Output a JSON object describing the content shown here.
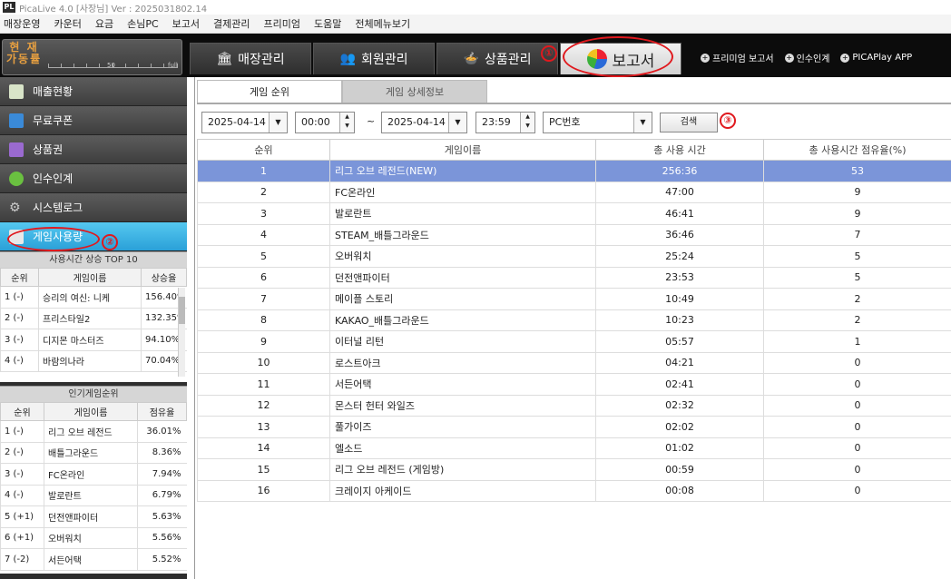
{
  "titlebar": {
    "logo": "PL",
    "title": "PicaLive 4.0 [사장님] Ver : 2025031802.14"
  },
  "menu": [
    "매장운영",
    "카운터",
    "요금",
    "손님PC",
    "보고서",
    "결제관리",
    "프리미엄",
    "도움말",
    "전체메뉴보기"
  ],
  "gauge": {
    "label_line1": "현 재",
    "label_line2": "가동률",
    "mark_mid": "50",
    "mark_end": "full"
  },
  "main_tabs": [
    {
      "label": "매장관리",
      "icon": "store-icon"
    },
    {
      "label": "회원관리",
      "icon": "members-icon"
    },
    {
      "label": "상품관리",
      "icon": "product-icon"
    },
    {
      "label": "보고서",
      "icon": "pie-chart-icon"
    }
  ],
  "top_links": [
    "프리미엄 보고서",
    "인수인계",
    "PICAPlay APP"
  ],
  "sidebar": {
    "items": [
      "매출현황",
      "무료쿠폰",
      "상품권",
      "인수인계",
      "시스템로그",
      "게임사용량"
    ],
    "active": "게임사용량"
  },
  "rising": {
    "title": "사용시간 상승 TOP 10",
    "headers": [
      "순위",
      "게임이름",
      "상승율"
    ],
    "rows": [
      [
        "1 (-)",
        "승리의 여신: 니케",
        "156.40%"
      ],
      [
        "2 (-)",
        "프리스타일2",
        "132.35%"
      ],
      [
        "3 (-)",
        "디지몬 마스터즈",
        "94.10%"
      ],
      [
        "4 (-)",
        "바람의나라",
        "70.04%"
      ]
    ]
  },
  "popular": {
    "title": "인기게임순위",
    "headers": [
      "순위",
      "게임이름",
      "점유율"
    ],
    "rows": [
      [
        "1 (-)",
        "리그 오브 레전드",
        "36.01%"
      ],
      [
        "2 (-)",
        "배틀그라운드",
        "8.36%"
      ],
      [
        "3 (-)",
        "FC온라인",
        "7.94%"
      ],
      [
        "4 (-)",
        "발로란트",
        "6.79%"
      ],
      [
        "5 (+1)",
        "던전앤파이터",
        "5.63%"
      ],
      [
        "6 (+1)",
        "오버워치",
        "5.56%"
      ],
      [
        "7 (-2)",
        "서든어택",
        "5.52%"
      ]
    ]
  },
  "subtabs": [
    "게임 순위",
    "게임 상세정보"
  ],
  "filters": {
    "start_date": "2025-04-14",
    "start_time": "00:00",
    "tilde": "~",
    "end_date": "2025-04-14",
    "end_time": "23:59",
    "select": "PC번호",
    "search_label": "검색"
  },
  "grid": {
    "headers": [
      "순위",
      "게임이름",
      "총 사용 시간",
      "총 사용시간 점유율(%)"
    ],
    "rows": [
      [
        "1",
        "리그 오브 레전드(NEW)",
        "256:36",
        "53"
      ],
      [
        "2",
        "FC온라인",
        "47:00",
        "9"
      ],
      [
        "3",
        "발로란트",
        "46:41",
        "9"
      ],
      [
        "4",
        "STEAM_배틀그라운드",
        "36:46",
        "7"
      ],
      [
        "5",
        "오버워치",
        "25:24",
        "5"
      ],
      [
        "6",
        "던전앤파이터",
        "23:53",
        "5"
      ],
      [
        "7",
        "메이플 스토리",
        "10:49",
        "2"
      ],
      [
        "8",
        "KAKAO_배틀그라운드",
        "10:23",
        "2"
      ],
      [
        "9",
        "이터널 리턴",
        "05:57",
        "1"
      ],
      [
        "10",
        "로스트아크",
        "04:21",
        "0"
      ],
      [
        "11",
        "서든어택",
        "02:41",
        "0"
      ],
      [
        "12",
        "몬스터 헌터 와일즈",
        "02:32",
        "0"
      ],
      [
        "13",
        "풀가이즈",
        "02:02",
        "0"
      ],
      [
        "14",
        "엘소드",
        "01:02",
        "0"
      ],
      [
        "15",
        "리그 오브 레전드 (게임방)",
        "00:59",
        "0"
      ],
      [
        "16",
        "크레이지 아케이드",
        "00:08",
        "0"
      ]
    ],
    "selected_row": 0
  },
  "annotations": [
    "①",
    "②",
    "③"
  ],
  "accent": "#e0191e"
}
